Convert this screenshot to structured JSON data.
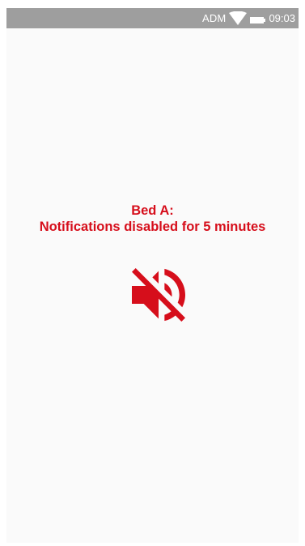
{
  "status_bar": {
    "carrier": "ADM",
    "time": "09:03",
    "wifi_icon": "wifi-icon",
    "battery_icon": "battery-icon"
  },
  "message": {
    "line1": "Bed A:",
    "line2": "Notifications disabled for 5 minutes"
  },
  "icon": {
    "name": "volume-off-icon",
    "color": "#d60e1b"
  },
  "colors": {
    "accent": "#d60e1b",
    "status_bar": "#9e9e9e",
    "background": "#fafafa"
  }
}
